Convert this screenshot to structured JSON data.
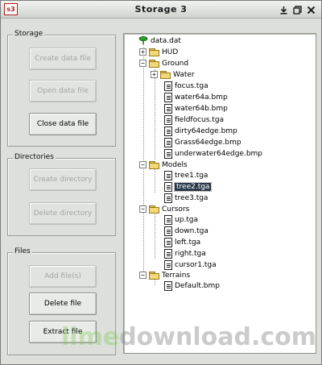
{
  "window": {
    "app_icon_text": "s3",
    "title": "Storage 3",
    "controls": [
      "download-icon",
      "restore-icon",
      "close-icon"
    ]
  },
  "groups": {
    "storage": {
      "label": "Storage",
      "buttons": [
        {
          "label": "Create data file",
          "enabled": false
        },
        {
          "label": "Open data file",
          "enabled": false
        },
        {
          "label": "Close data file",
          "enabled": true
        }
      ]
    },
    "directories": {
      "label": "Directories",
      "buttons": [
        {
          "label": "Create directory",
          "enabled": false
        },
        {
          "label": "Delete directory",
          "enabled": false
        }
      ]
    },
    "files": {
      "label": "Files",
      "buttons": [
        {
          "label": "Add file(s)",
          "enabled": false
        },
        {
          "label": "Delete file",
          "enabled": true
        },
        {
          "label": "Extract file",
          "enabled": true
        }
      ]
    }
  },
  "tree": {
    "root": "data.dat",
    "nodes": [
      {
        "label": "HUD",
        "type": "folder",
        "level": 1
      },
      {
        "label": "Ground",
        "type": "folder",
        "level": 1
      },
      {
        "label": "Water",
        "type": "folder",
        "level": 2
      },
      {
        "label": "focus.tga",
        "type": "file",
        "level": 2
      },
      {
        "label": "water64a.bmp",
        "type": "file",
        "level": 2
      },
      {
        "label": "water64b.bmp",
        "type": "file",
        "level": 2
      },
      {
        "label": "fieldfocus.tga",
        "type": "file",
        "level": 2
      },
      {
        "label": "dirty64edge.bmp",
        "type": "file",
        "level": 2
      },
      {
        "label": "Grass64edge.bmp",
        "type": "file",
        "level": 2
      },
      {
        "label": "underwater64edge.bmp",
        "type": "file",
        "level": 2
      },
      {
        "label": "Models",
        "type": "folder",
        "level": 1
      },
      {
        "label": "tree1.tga",
        "type": "file",
        "level": 2
      },
      {
        "label": "tree2.tga",
        "type": "file",
        "level": 2,
        "selected": true
      },
      {
        "label": "tree3.tga",
        "type": "file",
        "level": 2
      },
      {
        "label": "Cursors",
        "type": "folder",
        "level": 1
      },
      {
        "label": "up.tga",
        "type": "file",
        "level": 2
      },
      {
        "label": "down.tga",
        "type": "file",
        "level": 2
      },
      {
        "label": "left.tga",
        "type": "file",
        "level": 2
      },
      {
        "label": "right.tga",
        "type": "file",
        "level": 2
      },
      {
        "label": "cursor1.tga",
        "type": "file",
        "level": 2
      },
      {
        "label": "Terrains",
        "type": "folder",
        "level": 1
      },
      {
        "label": "Default.bmp",
        "type": "file",
        "level": 2
      }
    ]
  },
  "watermark": {
    "part1": "lime",
    "part2": "download.com"
  }
}
